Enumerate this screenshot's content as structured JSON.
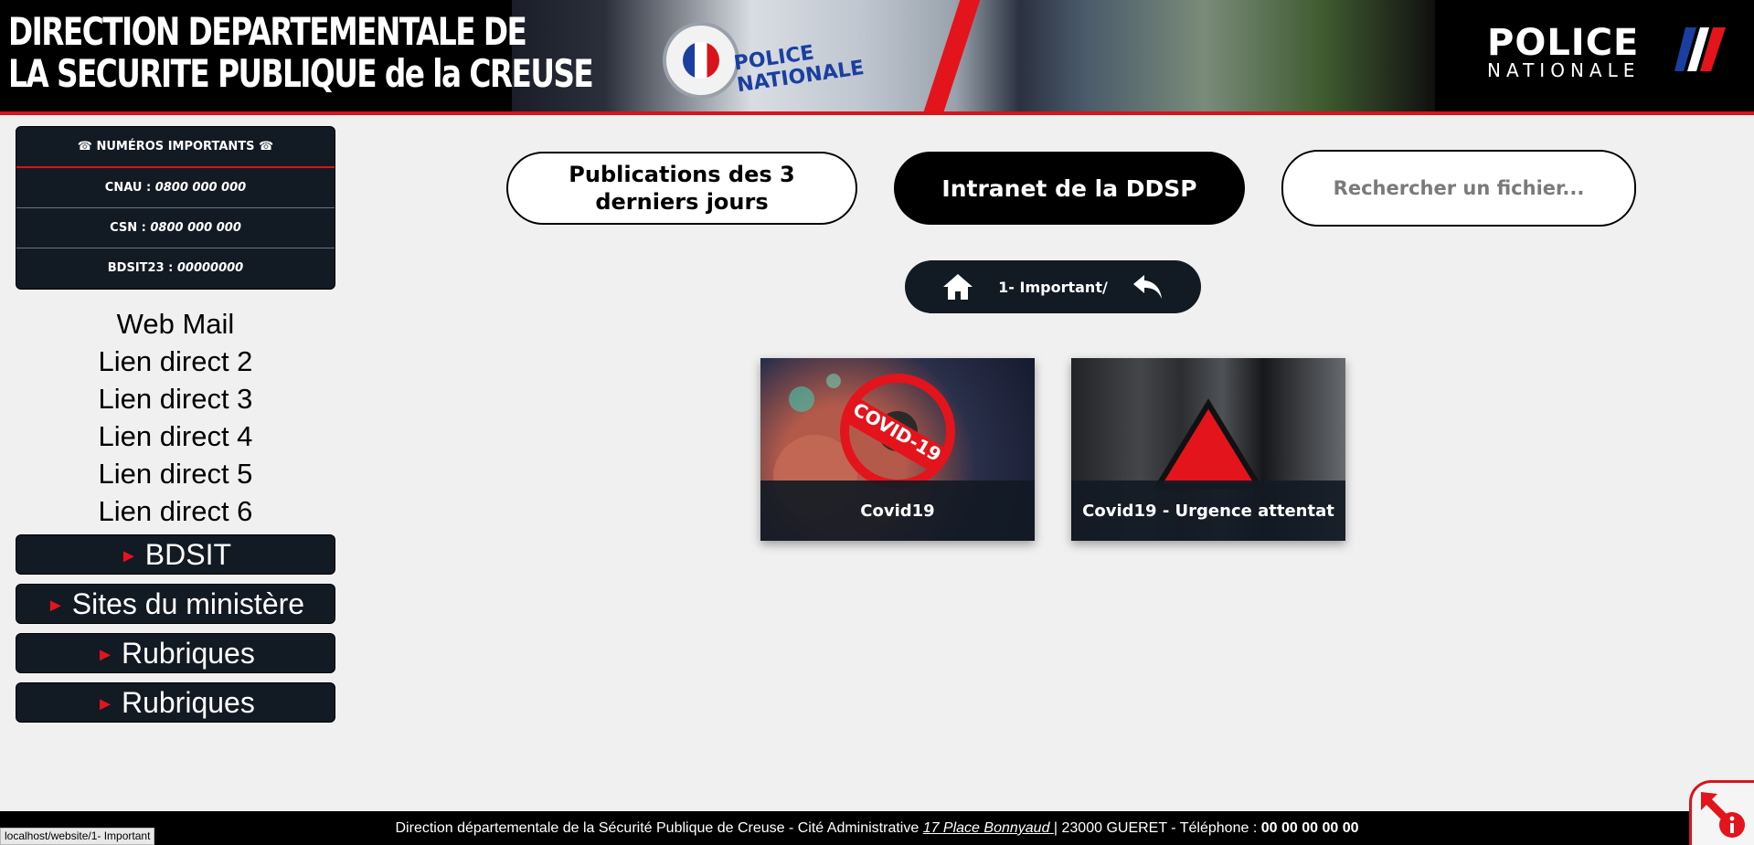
{
  "banner": {
    "title_line1": "DIRECTION DEPARTEMENTALE DE",
    "title_line2": "LA SECURITE PUBLIQUE de la CREUSE",
    "car_text": "POLICE NATIONALE",
    "logo_word1": "POLICE",
    "logo_word2": "NATIONALE"
  },
  "sidebar": {
    "numbers_title": "☎ NUMÉROS IMPORTANTS ☎",
    "numbers": [
      {
        "label": "CNAU : ",
        "value": "0800 000 000"
      },
      {
        "label": "CSN : ",
        "value": "0800 000 000"
      },
      {
        "label": "BDSIT23 : ",
        "value": "00000000"
      }
    ],
    "links": [
      "Web Mail",
      "Lien direct 2",
      "Lien direct 3",
      "Lien direct 4",
      "Lien direct 5",
      "Lien direct 6"
    ],
    "menus": [
      "BDSIT",
      "Sites du ministère",
      "Rubriques",
      "Rubriques"
    ]
  },
  "actions": {
    "publications_line1": "Publications des 3",
    "publications_line2": "derniers jours",
    "intranet": "Intranet de la DDSP",
    "search_placeholder": "Rechercher un fichier..."
  },
  "breadcrumb": {
    "path": "1- Important/",
    "home_icon": "home-icon",
    "back_icon": "back-arrow-icon"
  },
  "folders": [
    {
      "label": "Covid19"
    },
    {
      "label": "Covid19 - Urgence attentat"
    }
  ],
  "footer": {
    "text_prefix": "Direction départementale de la Sécurité Publique de Creuse - Cité Administrative ",
    "address": "17 Place Bonnyaud ",
    "text_mid": "| 23000 GUERET - Téléphone : ",
    "phone": "00 00 00 00 00"
  },
  "status_bar": {
    "url": "localhost/website/1- Important"
  },
  "colors": {
    "dark_panel": "#121a24",
    "accent_red": "#d8141a",
    "background": "#f0f0f0"
  }
}
